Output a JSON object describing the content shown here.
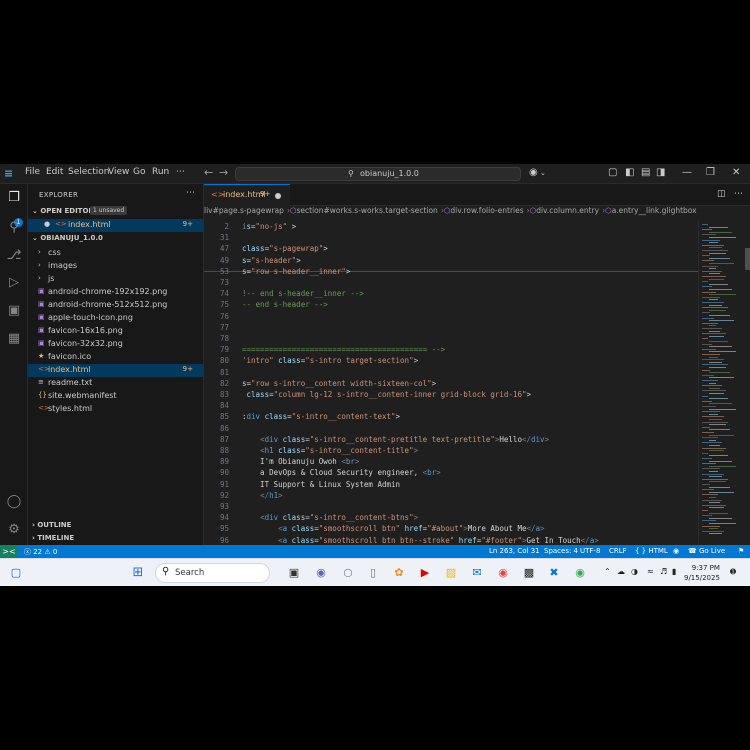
{
  "menu": [
    "File",
    "Edit",
    "Selection",
    "View",
    "Go",
    "Run"
  ],
  "search": {
    "label": "obianuju_1.0.0"
  },
  "explorer": {
    "title": "EXPLORER",
    "open_editors_label": "OPEN EDITORS",
    "unsaved_badge": "1 unsaved",
    "open_file": {
      "name": "index.html",
      "count": "9+"
    },
    "project_label": "OBIANUJU_1.0.0",
    "folders": [
      "css",
      "images",
      "js"
    ],
    "files": [
      {
        "name": "android-chrome-192x192.png",
        "icon": "image-icon",
        "color": "#b180d7"
      },
      {
        "name": "android-chrome-512x512.png",
        "icon": "image-icon",
        "color": "#b180d7"
      },
      {
        "name": "apple-touch-icon.png",
        "icon": "image-icon",
        "color": "#b180d7"
      },
      {
        "name": "favicon-16x16.png",
        "icon": "image-icon",
        "color": "#b180d7"
      },
      {
        "name": "favicon-32x32.png",
        "icon": "image-icon",
        "color": "#b180d7"
      },
      {
        "name": "favicon.ico",
        "icon": "star-icon",
        "color": "#e5c07b"
      },
      {
        "name": "index.html",
        "icon": "html-icon",
        "color": "#e37933",
        "count": "9+"
      },
      {
        "name": "readme.txt",
        "icon": "lines-icon",
        "color": "#cccccc"
      },
      {
        "name": "site.webmanifest",
        "icon": "braces-icon",
        "color": "#e5c07b"
      },
      {
        "name": "styles.html",
        "icon": "html-icon",
        "color": "#e37933"
      }
    ],
    "outline_label": "OUTLINE",
    "timeline_label": "TIMELINE"
  },
  "activity": {
    "badge": "1"
  },
  "tab": {
    "name": "index.html",
    "count": "9+"
  },
  "breadcrumbs": [
    "liv#page.s-pagewrap",
    "section#works.s-works.target-section",
    "div.row.folio-entries",
    "div.column.entry",
    "a.entry__link.glightbox",
    "div.entry__info"
  ],
  "code": [
    {
      "n": "2",
      "seg": [
        [
          "gy",
          "i"
        ],
        [
          "at",
          "s"
        ],
        [
          "tx",
          "="
        ],
        [
          "str",
          "\"no-js\""
        ],
        [
          "tx",
          " >"
        ]
      ]
    },
    {
      "n": "31",
      "seg": []
    },
    {
      "n": "47",
      "seg": [
        [
          "at",
          "class"
        ],
        [
          "tx",
          "="
        ],
        [
          "str",
          "\"s-pagewrap\""
        ],
        [
          "tx",
          ">"
        ]
      ]
    },
    {
      "n": "49",
      "seg": [
        [
          "at",
          "s"
        ],
        [
          "tx",
          "="
        ],
        [
          "str",
          "\"s-header\""
        ],
        [
          "tx",
          ">"
        ]
      ]
    },
    {
      "n": "53",
      "seg": [
        [
          "at",
          "s"
        ],
        [
          "tx",
          "="
        ],
        [
          "str",
          "\"row s-header__inner\""
        ],
        [
          "tx",
          ">"
        ]
      ]
    },
    {
      "n": "73",
      "seg": []
    },
    {
      "n": "74",
      "seg": [
        [
          "cm",
          "!-- end s-header__inner -->"
        ]
      ]
    },
    {
      "n": "75",
      "seg": [
        [
          "cm",
          "-- end s-header -->"
        ]
      ]
    },
    {
      "n": "76",
      "seg": []
    },
    {
      "n": "77",
      "seg": []
    },
    {
      "n": "78",
      "seg": []
    },
    {
      "n": "79",
      "seg": [
        [
          "cm",
          "========================================= -->"
        ]
      ]
    },
    {
      "n": "80",
      "seg": [
        [
          "str",
          "'intro\""
        ],
        [
          "tx",
          " "
        ],
        [
          "at",
          "class"
        ],
        [
          "tx",
          "="
        ],
        [
          "str",
          "\"s-intro target-section\""
        ],
        [
          "tx",
          ">"
        ]
      ]
    },
    {
      "n": "81",
      "seg": []
    },
    {
      "n": "82",
      "seg": [
        [
          "at",
          "s"
        ],
        [
          "tx",
          "="
        ],
        [
          "str",
          "\"row s-intro__content width-sixteen-col\""
        ],
        [
          "tx",
          ">"
        ]
      ]
    },
    {
      "n": "83",
      "seg": [
        [
          "tx",
          " "
        ],
        [
          "at",
          "class"
        ],
        [
          "tx",
          "="
        ],
        [
          "str",
          "\"column lg-12 s-intro__content-inner grid-block grid-16\""
        ],
        [
          "tx",
          ">"
        ]
      ]
    },
    {
      "n": "84",
      "seg": []
    },
    {
      "n": "85",
      "seg": [
        [
          "tx",
          ":"
        ],
        [
          "tag",
          "div"
        ],
        [
          "tx",
          " "
        ],
        [
          "at",
          "class"
        ],
        [
          "tx",
          "="
        ],
        [
          "str",
          "\"s-intro__content-text\""
        ],
        [
          "tx",
          ">"
        ]
      ]
    },
    {
      "n": "86",
      "seg": []
    },
    {
      "n": "87",
      "seg": [
        [
          "tx",
          "    "
        ],
        [
          "gy",
          "<"
        ],
        [
          "tag",
          "div"
        ],
        [
          "tx",
          " "
        ],
        [
          "at",
          "class"
        ],
        [
          "tx",
          "="
        ],
        [
          "str",
          "\"s-intro__content-pretitle text-pretitle\""
        ],
        [
          "gy",
          ">"
        ],
        [
          "tx",
          "Hello"
        ],
        [
          "gy",
          "</"
        ],
        [
          "tag",
          "div"
        ],
        [
          "gy",
          ">"
        ]
      ]
    },
    {
      "n": "88",
      "seg": [
        [
          "tx",
          "    "
        ],
        [
          "gy",
          "<"
        ],
        [
          "tag",
          "h1"
        ],
        [
          "tx",
          " "
        ],
        [
          "at",
          "class"
        ],
        [
          "tx",
          "="
        ],
        [
          "str",
          "\"s-intro__content-title\""
        ],
        [
          "gy",
          ">"
        ]
      ]
    },
    {
      "n": "89",
      "seg": [
        [
          "tx",
          "    I'm Obianuju Owoh "
        ],
        [
          "gy",
          "<"
        ],
        [
          "tag",
          "br"
        ],
        [
          "gy",
          ">"
        ]
      ]
    },
    {
      "n": "90",
      "seg": [
        [
          "tx",
          "    a DevOps & Cloud Security engineer, "
        ],
        [
          "gy",
          "<"
        ],
        [
          "tag",
          "br"
        ],
        [
          "gy",
          ">"
        ]
      ]
    },
    {
      "n": "91",
      "seg": [
        [
          "tx",
          "    IT Support & Linux System Admin"
        ]
      ]
    },
    {
      "n": "92",
      "seg": [
        [
          "tx",
          "    "
        ],
        [
          "gy",
          "</"
        ],
        [
          "tag",
          "h1"
        ],
        [
          "gy",
          ">"
        ]
      ]
    },
    {
      "n": "93",
      "seg": []
    },
    {
      "n": "94",
      "seg": [
        [
          "tx",
          "    "
        ],
        [
          "gy",
          "<"
        ],
        [
          "tag",
          "div"
        ],
        [
          "tx",
          " "
        ],
        [
          "at",
          "class"
        ],
        [
          "tx",
          "="
        ],
        [
          "str",
          "\"s-intro__content-btns\""
        ],
        [
          "gy",
          ">"
        ]
      ]
    },
    {
      "n": "95",
      "seg": [
        [
          "tx",
          "        "
        ],
        [
          "gy",
          "<"
        ],
        [
          "tag",
          "a"
        ],
        [
          "tx",
          " "
        ],
        [
          "at",
          "class"
        ],
        [
          "tx",
          "="
        ],
        [
          "str",
          "\"smoothscroll btn\""
        ],
        [
          "tx",
          " "
        ],
        [
          "at",
          "href"
        ],
        [
          "tx",
          "="
        ],
        [
          "str",
          "\"#about\""
        ],
        [
          "gy",
          ">"
        ],
        [
          "tx",
          "More About Me"
        ],
        [
          "gy",
          "</"
        ],
        [
          "tag",
          "a"
        ],
        [
          "gy",
          ">"
        ]
      ]
    },
    {
      "n": "96",
      "seg": [
        [
          "tx",
          "        "
        ],
        [
          "gy",
          "<"
        ],
        [
          "tag",
          "a"
        ],
        [
          "tx",
          " "
        ],
        [
          "at",
          "class"
        ],
        [
          "tx",
          "="
        ],
        [
          "str",
          "\"smoothscroll btn btn--stroke\""
        ],
        [
          "tx",
          " "
        ],
        [
          "at",
          "href"
        ],
        [
          "tx",
          "="
        ],
        [
          "str",
          "\"#footer\""
        ],
        [
          "gy",
          ">"
        ],
        [
          "tx",
          "Get In Touch"
        ],
        [
          "gy",
          "</"
        ],
        [
          "tag",
          "a"
        ],
        [
          "gy",
          ">"
        ]
      ]
    }
  ],
  "status": {
    "remote": "><",
    "problems": "ⓧ 22 ⚠ 0",
    "position": "Ln 263, Col 31",
    "spaces": "Spaces: 4",
    "encoding": "UTF-8",
    "eol": "CRLF",
    "language": "{ } HTML",
    "golive": "Go Live"
  },
  "taskbar": {
    "search_placeholder": "Search",
    "time": "9:37 PM",
    "date": "9/15/2025"
  },
  "colors": {
    "accent": "#0078d4",
    "status": "#0078d4",
    "remote": "#16825d"
  }
}
